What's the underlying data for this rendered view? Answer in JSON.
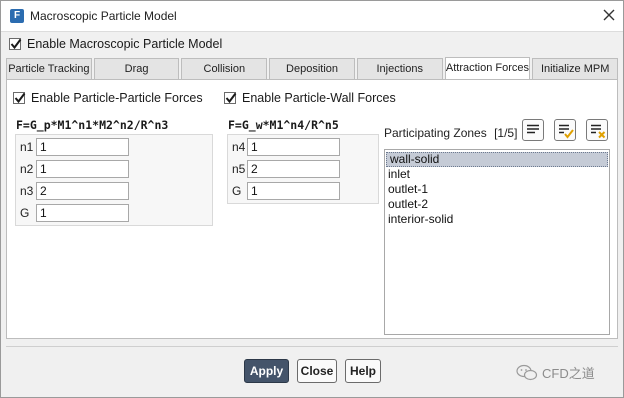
{
  "window": {
    "title": "Macroscopic Particle Model",
    "app_icon_letter": "F"
  },
  "enable_model": {
    "label": "Enable Macroscopic Particle Model",
    "checked": true
  },
  "tabs": [
    {
      "label": "Particle Tracking",
      "active": false
    },
    {
      "label": "Drag",
      "active": false
    },
    {
      "label": "Collision",
      "active": false
    },
    {
      "label": "Deposition",
      "active": false
    },
    {
      "label": "Injections",
      "active": false
    },
    {
      "label": "Attraction Forces",
      "active": true
    },
    {
      "label": "Initialize MPM",
      "active": false
    }
  ],
  "particle_particle": {
    "label": "Enable Particle-Particle Forces",
    "checked": true,
    "formula": "F=G_p*M1^n1*M2^n2/R^n3",
    "params": [
      {
        "label": "n1",
        "value": "1"
      },
      {
        "label": "n2",
        "value": "1"
      },
      {
        "label": "n3",
        "value": "2"
      },
      {
        "label": "G",
        "value": "1"
      }
    ]
  },
  "particle_wall": {
    "label": "Enable Particle-Wall Forces",
    "checked": true,
    "formula": "F=G_w*M1^n4/R^n5",
    "params": [
      {
        "label": "n4",
        "value": "1"
      },
      {
        "label": "n5",
        "value": "2"
      },
      {
        "label": "G",
        "value": "1"
      }
    ]
  },
  "zones": {
    "label": "Participating Zones",
    "count": "[1/5]",
    "items": [
      "wall-solid",
      "inlet",
      "outlet-1",
      "outlet-2",
      "interior-solid"
    ],
    "selected_index": 0
  },
  "buttons": {
    "apply": "Apply",
    "close": "Close",
    "help": "Help"
  },
  "watermark": {
    "text": "CFD之道"
  },
  "colors": {
    "primary_button": "#44546a",
    "selection": "#c5cbd6"
  }
}
